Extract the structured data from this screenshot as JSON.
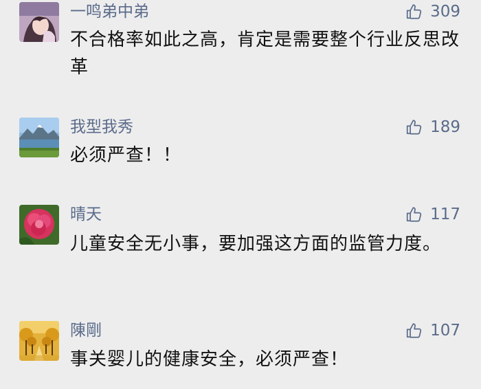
{
  "comments": [
    {
      "nickname": "一鸣弟中弟",
      "likes": "309",
      "text": "不合格率如此之高，肯定是需要整个行业反思改革",
      "avatar": "anime-girl-avatar"
    },
    {
      "nickname": "我型我秀",
      "likes": "189",
      "text": "必须严查！！",
      "avatar": "lake-mountain-avatar"
    },
    {
      "nickname": "晴天",
      "likes": "117",
      "text": "儿童安全无小事，要加强这方面的监管力度。",
      "avatar": "pink-peony-avatar"
    },
    {
      "nickname": "陳剛",
      "likes": "107",
      "text": "事关婴儿的健康安全，必须严查！",
      "avatar": "ginkgo-avenue-avatar"
    }
  ],
  "colors": {
    "background": "#ededed",
    "nickname": "#5a6b8a",
    "text": "#111111",
    "likes": "#5a6b8a"
  },
  "icons": {
    "like": "thumbs-up-icon"
  }
}
